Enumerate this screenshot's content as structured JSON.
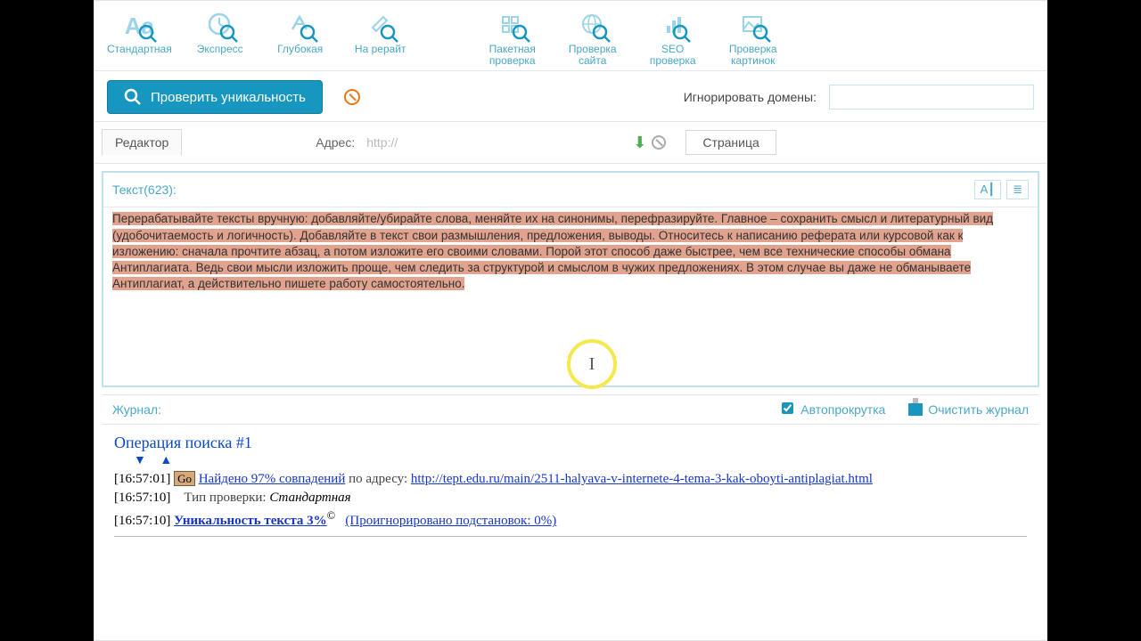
{
  "colors": {
    "accent": "#1796c0",
    "highlight": "#e2a38e",
    "link": "#1536c9"
  },
  "toolbar": {
    "left": [
      {
        "label": "Стандартная",
        "icon": "font-icon"
      },
      {
        "label": "Экспресс",
        "icon": "clock-icon"
      },
      {
        "label": "Глубокая",
        "icon": "deep-icon"
      },
      {
        "label": "На рерайт",
        "icon": "pen-icon"
      }
    ],
    "right": [
      {
        "label": "Пакетная\nпроверка",
        "icon": "batch-icon"
      },
      {
        "label": "Проверка\nсайта",
        "icon": "globe-icon"
      },
      {
        "label": "SEO\nпроверка",
        "icon": "seo-icon"
      },
      {
        "label": "Проверка\nкартинок",
        "icon": "image-icon"
      }
    ]
  },
  "action": {
    "check_label": "Проверить уникальность",
    "ignore_label": "Игнорировать домены:",
    "ignore_value": ""
  },
  "editor": {
    "tab": "Редактор",
    "addr_label": "Адрес:",
    "addr_value": "http://",
    "page_tab": "Страница",
    "text_label": "Текст(623):",
    "body": "Перерабатывайте тексты вручную: добавляйте/убирайте слова, меняйте их на синонимы, перефразируйте. Главное – сохранить смысл и литературный вид (удобочитаемость и логичность).\nДобавляйте в текст свои размышления, предложения, выводы. Относитесь к написанию реферата или курсовой как к изложению: сначала прочтите абзац, а потом изложите его своими словами. Порой этот способ даже быстрее, чем все технические способы обмана Антиплагиата. Ведь свои мысли изложить проще, чем следить за структурой и смыслом в чужих предложениях. В этом случае вы даже не обманываете Антиплагиат, а действительно пишете работу самостоятельно."
  },
  "journal": {
    "title": "Журнал:",
    "autoscroll": "Автопрокрутка",
    "clear": "Очистить журнал",
    "op_title": "Операция поиска #1",
    "lines": [
      {
        "time": "[16:57:01]",
        "go": "Go",
        "link_text": "Найдено 97% совпадений",
        "after": " по адресу: ",
        "url": "http://tept.edu.ru/main/2511-halyava-v-internete-4-tema-3-kak-oboyti-antiplagiat.html"
      },
      {
        "time": "[16:57:10]",
        "label": "Тип проверки: ",
        "value": "Стандартная"
      },
      {
        "time": "[16:57:10]",
        "bold_link": "Уникальность текста 3%",
        "sup": "©",
        "paren_link": "(Проигнорировано подстановок: 0%)"
      }
    ]
  }
}
